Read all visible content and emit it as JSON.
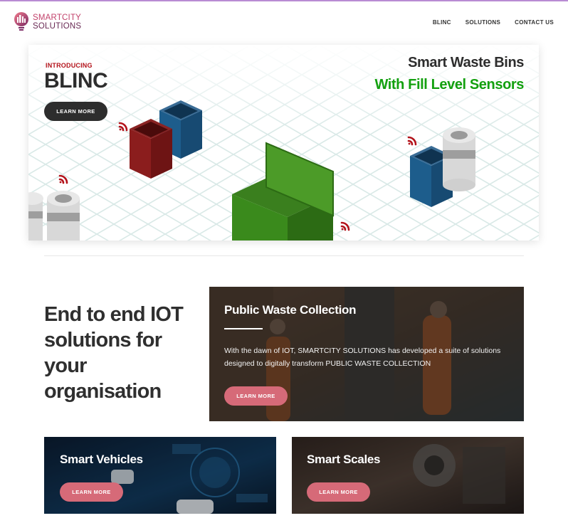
{
  "header": {
    "logo_line1": "SMARTCITY",
    "logo_line2": "SOLUTIONS",
    "nav": [
      {
        "label": "BLINC"
      },
      {
        "label": "SOLUTIONS"
      },
      {
        "label": "CONTACT US"
      }
    ]
  },
  "hero": {
    "eyebrow": "INTRODUCING",
    "title": "BLINC",
    "button": "LEARN MORE",
    "headline": "Smart Waste Bins",
    "subheadline": "With Fill Level Sensors"
  },
  "lead": {
    "text": "End to end IOT solutions for your organisation"
  },
  "cards": {
    "public_waste": {
      "title": "Public Waste Collection",
      "description": "With the dawn of IOT, SMARTCITY SOLUTIONS has developed a suite of solutions designed to digitally transform PUBLIC WASTE COLLECTION",
      "button": "LEARN MORE"
    },
    "smart_vehicles": {
      "title": "Smart Vehicles",
      "button": "LEARN MORE"
    },
    "smart_scales": {
      "title": "Smart Scales",
      "button": "LEARN MORE"
    }
  },
  "colors": {
    "accent_pink": "#d66a78",
    "brand_green": "#13a00f",
    "brand_red": "#b3121a",
    "dark": "#2d2d2d"
  }
}
